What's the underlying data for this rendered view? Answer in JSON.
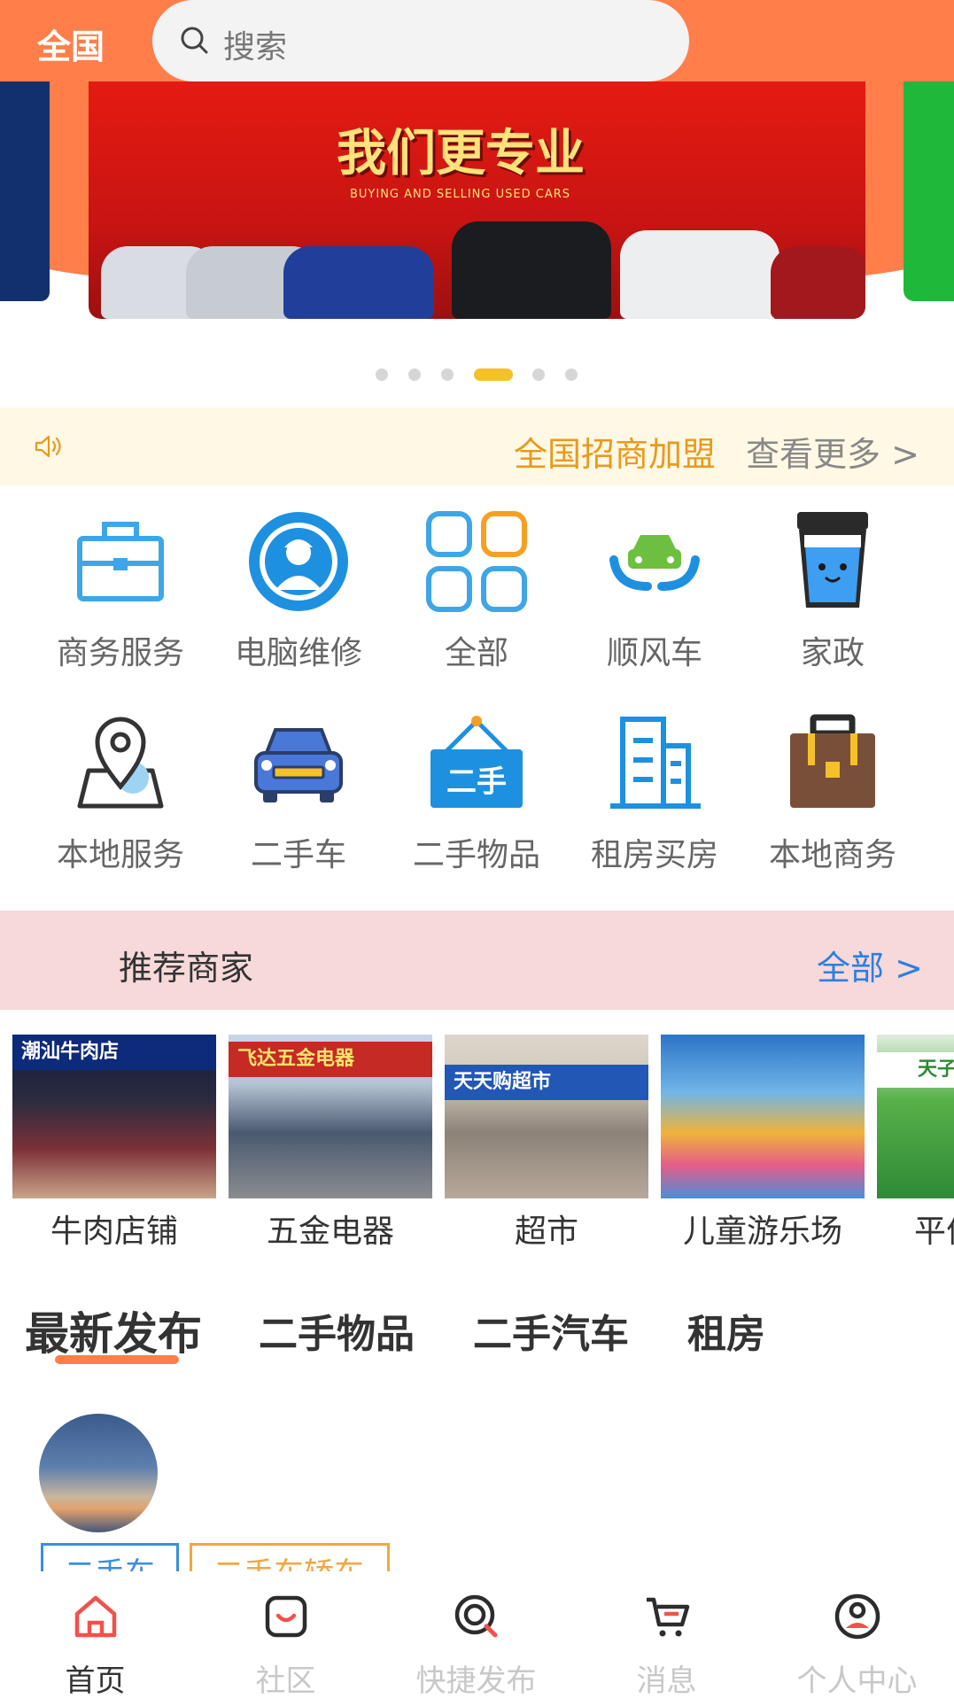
{
  "header": {
    "city": "全国",
    "search_placeholder": "搜索"
  },
  "banner": {
    "slogan": "我们更专业",
    "subtitle": "BUYING AND SELLING USED CARS",
    "slide_count": 6,
    "active_slide": 3
  },
  "notice": {
    "text": "全国招商加盟",
    "more": "查看更多 >"
  },
  "categories": [
    {
      "label": "商务服务",
      "icon": "briefcase-icon"
    },
    {
      "label": "电脑维修",
      "icon": "technician-icon"
    },
    {
      "label": "全部",
      "icon": "grid-icon"
    },
    {
      "label": "顺风车",
      "icon": "carpool-icon"
    },
    {
      "label": "家政",
      "icon": "cup-icon"
    },
    {
      "label": "本地服务",
      "icon": "location-map-icon"
    },
    {
      "label": "二手车",
      "icon": "car-icon"
    },
    {
      "label": "二手物品",
      "icon": "secondhand-sign-icon"
    },
    {
      "label": "租房买房",
      "icon": "building-icon"
    },
    {
      "label": "本地商务",
      "icon": "bag-icon"
    }
  ],
  "merchants": {
    "title": "推荐商家",
    "all": "全部 >",
    "items": [
      {
        "name": "牛肉店铺",
        "sign": "潮汕牛肉店"
      },
      {
        "name": "五金电器",
        "sign": "飞达五金电器"
      },
      {
        "name": "超市",
        "sign": "天天购超市"
      },
      {
        "name": "儿童游乐场",
        "sign": ""
      },
      {
        "name": "平价",
        "sign": "天子"
      }
    ]
  },
  "feed_tabs": [
    "最新发布",
    "二手物品",
    "二手汽车",
    "租房"
  ],
  "post": {
    "tags": [
      "二手车",
      "二手车轿车"
    ]
  },
  "bottom_nav": [
    {
      "label": "首页",
      "icon": "home-icon",
      "active": true
    },
    {
      "label": "社区",
      "icon": "community-icon",
      "active": false
    },
    {
      "label": "快捷发布",
      "icon": "quick-publish-icon",
      "active": false
    },
    {
      "label": "消息",
      "icon": "cart-message-icon",
      "active": false
    },
    {
      "label": "个人中心",
      "icon": "user-center-icon",
      "active": false
    }
  ],
  "colors": {
    "brand": "#ff7e4a",
    "link": "#2b7fe3",
    "notice": "#e79a1e",
    "recommend_bg": "#f7d9da"
  }
}
